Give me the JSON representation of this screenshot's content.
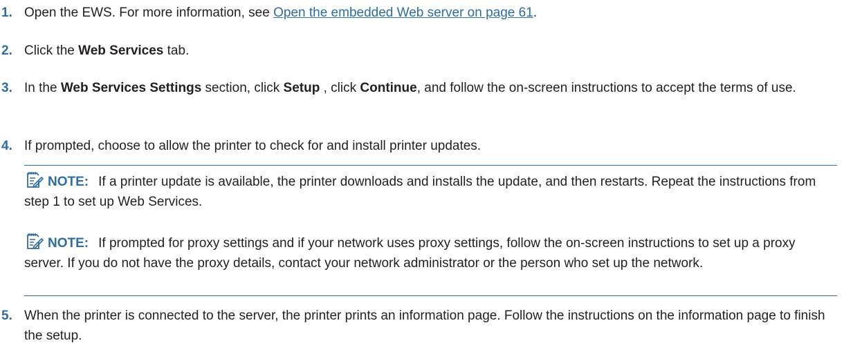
{
  "steps": [
    {
      "num": "1.",
      "parts": {
        "a": "Open the EWS. For more information, see ",
        "link": "Open the embedded Web server on page 61",
        "b": "."
      }
    },
    {
      "num": "2.",
      "parts": {
        "a": "Click the ",
        "bold1": "Web Services",
        "b": " tab."
      }
    },
    {
      "num": "3.",
      "parts": {
        "a": "In the ",
        "bold1": "Web Services Settings",
        "b": " section, click ",
        "bold2": "Setup",
        "c": " , click ",
        "bold3": "Continue",
        "d": ", and follow the on-screen instructions to accept the terms of use."
      }
    },
    {
      "num": "4.",
      "text": "If prompted, choose to allow the printer to check for and install printer updates."
    },
    {
      "num": "5.",
      "text": "When the printer is connected to the server, the printer prints an information page. Follow the instructions on the information page to finish the setup."
    }
  ],
  "notes": [
    {
      "label": "NOTE:",
      "text": "If a printer update is available, the printer downloads and installs the update, and then restarts. Repeat the instructions from step 1 to set up Web Services."
    },
    {
      "label": "NOTE:",
      "text": "If prompted for proxy settings and if your network uses proxy settings, follow the on-screen instructions to set up a proxy server. If you do not have the proxy details, contact your network administrator or the person who set up the network."
    }
  ],
  "icons": {
    "note": "note-pad-pencil-icon"
  },
  "colors": {
    "accent": "#2e6ca4",
    "text": "#231f20"
  }
}
